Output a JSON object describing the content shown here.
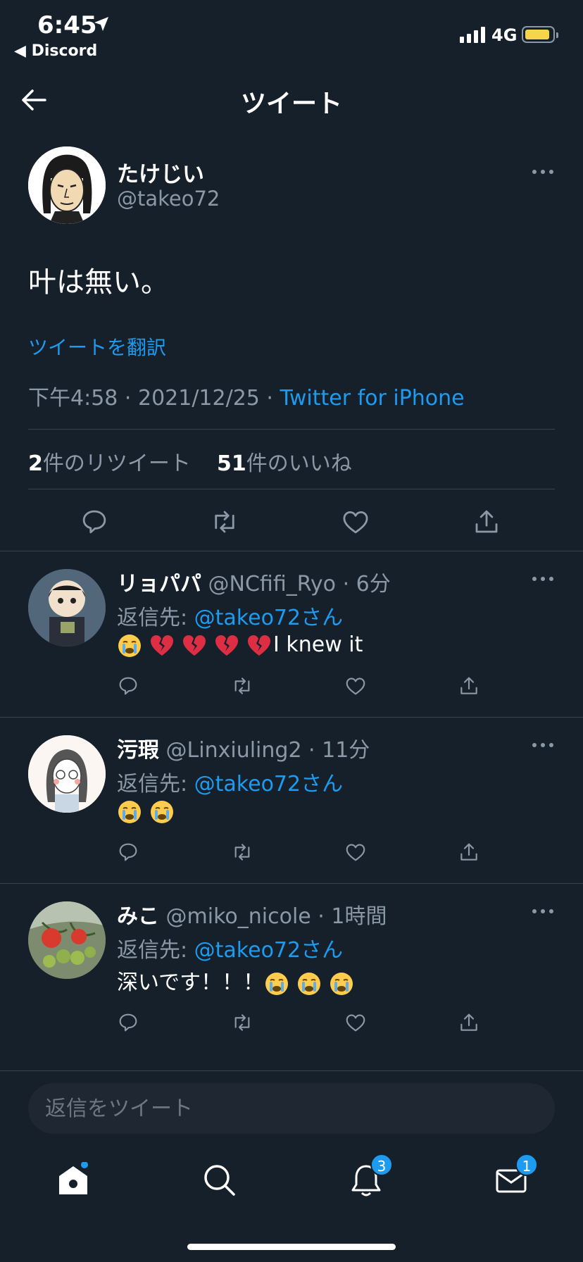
{
  "status_bar": {
    "time": "6:45",
    "back_app": "◀ Discord",
    "network": "4G"
  },
  "header": {
    "title": "ツイート"
  },
  "tweet": {
    "name": "たけじい",
    "handle": "@takeo72",
    "text": "叶は無い。",
    "translate": "ツイートを翻訳",
    "time": "下午4:58 · 2021/12/25 · ",
    "source": "Twitter for iPhone",
    "retweet_count": "2",
    "retweet_label": "件のリツイート",
    "like_count": "51",
    "like_label": "件のいいね"
  },
  "replies": [
    {
      "name": "リョパパ",
      "handle": "@NCfifi_Ryo · 6分",
      "reply_prefix": "返信先: ",
      "reply_to": "@takeo72さん",
      "text": "I knew it",
      "emojis": [
        "sob",
        "broken-heart",
        "broken-heart",
        "broken-heart",
        "broken-heart"
      ]
    },
    {
      "name": "污瑕",
      "handle": "@Linxiuling2 · 11分",
      "reply_prefix": "返信先: ",
      "reply_to": "@takeo72さん",
      "text": "",
      "emojis": [
        "sob",
        "sob"
      ]
    },
    {
      "name": "みこ",
      "handle": "@miko_nicole · 1時間",
      "reply_prefix": "返信先: ",
      "reply_to": "@takeo72さん",
      "text": "深いです！！！",
      "emojis": [
        "sob",
        "sob",
        "sob"
      ]
    }
  ],
  "composer": {
    "placeholder": "返信をツイート"
  },
  "tabbar": {
    "notifications_badge": "3",
    "messages_badge": "1"
  },
  "colors": {
    "background": "#15202b",
    "accent": "#1d9bf0",
    "muted": "#8b98a5",
    "divider": "#38444d"
  }
}
